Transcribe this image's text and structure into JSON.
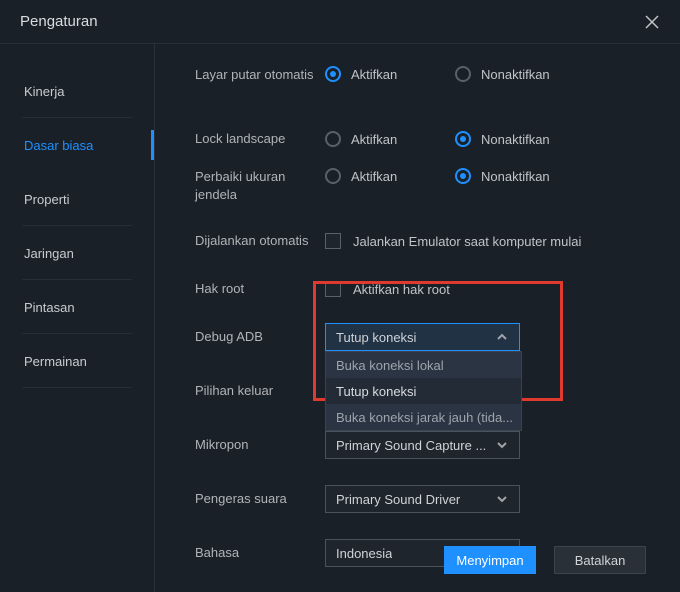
{
  "window": {
    "title": "Pengaturan"
  },
  "sidebar": {
    "items": [
      {
        "label": "Kinerja"
      },
      {
        "label": "Dasar biasa"
      },
      {
        "label": "Properti"
      },
      {
        "label": "Jaringan"
      },
      {
        "label": "Pintasan"
      },
      {
        "label": "Permainan"
      }
    ],
    "active_index": 1
  },
  "settings": {
    "auto_rotate": {
      "label": "Layar putar otomatis",
      "enable": "Aktifkan",
      "disable": "Nonaktifkan"
    },
    "lock_landscape": {
      "label": "Lock landscape",
      "enable": "Aktifkan",
      "disable": "Nonaktifkan"
    },
    "fix_window": {
      "label": "Perbaiki ukuran jendela",
      "enable": "Aktifkan",
      "disable": "Nonaktifkan"
    },
    "autorun": {
      "label": "Dijalankan otomatis",
      "checkbox": "Jalankan Emulator saat komputer mulai"
    },
    "root": {
      "label": "Hak root",
      "checkbox": "Aktifkan hak root"
    },
    "adb": {
      "label": "Debug ADB",
      "selected": "Tutup koneksi",
      "options": [
        "Buka koneksi lokal",
        "Tutup koneksi",
        "Buka koneksi jarak jauh (tida..."
      ]
    },
    "exit_opt": {
      "label": "Pilihan keluar"
    },
    "mic": {
      "label": "Mikropon",
      "value": "Primary Sound Capture ..."
    },
    "speaker": {
      "label": "Pengeras suara",
      "value": "Primary Sound Driver"
    },
    "language": {
      "label": "Bahasa",
      "value": "Indonesia"
    }
  },
  "footer": {
    "save": "Menyimpan",
    "cancel": "Batalkan"
  }
}
